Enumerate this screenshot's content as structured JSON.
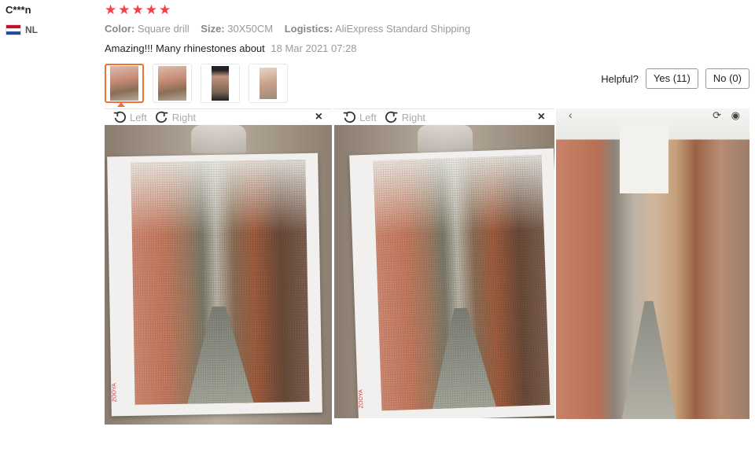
{
  "reviewer": {
    "name": "C***n",
    "country": "NL"
  },
  "rating": {
    "stars": 5,
    "max": 5,
    "color": "#f44141"
  },
  "attributes": [
    {
      "key": "Color:",
      "value": "Square drill"
    },
    {
      "key": "Size:",
      "value": "30X50CM"
    },
    {
      "key": "Logistics:",
      "value": "AliExpress Standard Shipping"
    }
  ],
  "review": {
    "text": "Amazing!!! Many rhinestones about",
    "date": "18 Mar 2021 07:28"
  },
  "thumbnails": [
    {
      "name": "thumbnail-1",
      "active": true
    },
    {
      "name": "thumbnail-2",
      "active": false
    },
    {
      "name": "thumbnail-3",
      "active": false
    },
    {
      "name": "thumbnail-4",
      "active": false
    }
  ],
  "helpful": {
    "label": "Helpful?",
    "yes": "Yes (11)",
    "no": "No (0)"
  },
  "viewer": {
    "left_label": "Left",
    "right_label": "Right",
    "close": "×",
    "back": "‹"
  },
  "accent_color": "#f07033"
}
